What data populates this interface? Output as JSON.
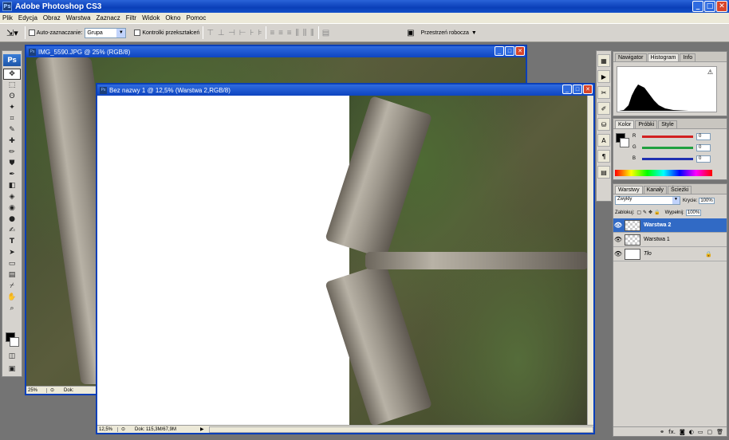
{
  "app": {
    "title": "Adobe Photoshop CS3",
    "logo": "Ps"
  },
  "menu": [
    "Plik",
    "Edycja",
    "Obraz",
    "Warstwa",
    "Zaznacz",
    "Filtr",
    "Widok",
    "Okno",
    "Pomoc"
  ],
  "options": {
    "auto_select_label": "Auto-zaznaczanie:",
    "auto_select_value": "Grupa",
    "transform_label": "Kontrolki przekształceń",
    "workspace_label": "Przestrzeń robocza"
  },
  "doc1": {
    "title": "IMG_5590.JPG @ 25% (RGB/8)",
    "zoom": "25%",
    "doc": "Dok:"
  },
  "doc2": {
    "title": "Bez nazwy 1 @ 12,5% (Warstwa 2,RGB/8)",
    "zoom": "12,5%",
    "doc": "Dok: 115,3M/67,9M"
  },
  "nav_panel": {
    "tabs": [
      "Nawigator",
      "Histogram",
      "Info"
    ],
    "active_tab": "Histogram"
  },
  "color_panel": {
    "tabs": [
      "Kolor",
      "Próbki",
      "Style"
    ],
    "channels": [
      {
        "label": "R",
        "value": "0",
        "color": "#d22020"
      },
      {
        "label": "G",
        "value": "0",
        "color": "#20a040"
      },
      {
        "label": "B",
        "value": "0",
        "color": "#2030b0"
      }
    ]
  },
  "layers_panel": {
    "tabs": [
      "Warstwy",
      "Kanały",
      "Ścieżki"
    ],
    "blend_mode": "Zwykły",
    "opacity_label": "Krycie:",
    "opacity": "100%",
    "lock_label": "Zablokuj:",
    "fill_label": "Wypełnij:",
    "fill": "100%",
    "layers": [
      {
        "name": "Warstwa 2",
        "selected": true
      },
      {
        "name": "Warstwa 1",
        "selected": false
      },
      {
        "name": "Tło",
        "selected": false
      }
    ],
    "footer_fx": "fx."
  },
  "colors": {
    "accent": "#0a3fb8",
    "selection": "#316ac5"
  }
}
